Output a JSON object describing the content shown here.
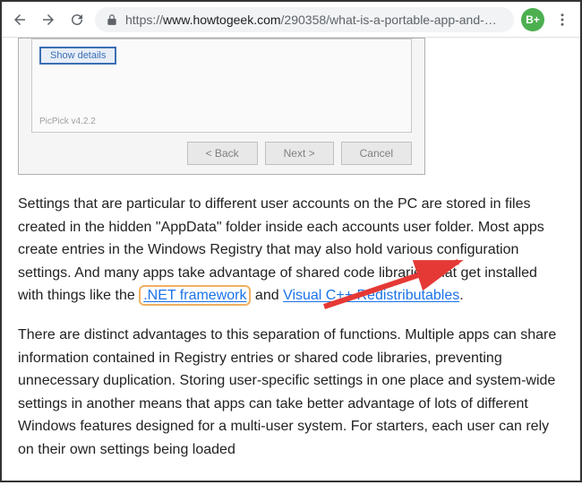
{
  "browser": {
    "url_scheme": "https://",
    "url_host": "www.howtogeek.com",
    "url_path": "/290358/what-is-a-portable-app-and-…",
    "ext_badge": "B+"
  },
  "installer": {
    "show_details": "Show details",
    "version": "PicPick v4.2.2",
    "back": "< Back",
    "next": "Next >",
    "cancel": "Cancel"
  },
  "article": {
    "p1a": "Settings that are particular to different user accounts on the PC are stored in files created in the hidden \"AppData\" folder inside each accounts user folder. Most apps create entries in the Windows Registry that may also hold various configuration settings. And many apps take advantage of shared code libraries that get installed with things like the ",
    "link_net": ".NET framework",
    "p1b": " and ",
    "link_vc": "Visual C++ Redistributables",
    "p1c": ".",
    "p2": "There are distinct advantages to this separation of functions. Multiple apps can share information contained in Registry entries or shared code libraries, preventing unnecessary duplication. Storing user-specific settings in one place and system-wide settings in another means that apps can take better advantage of lots of different Windows features designed for a multi-user system. For starters, each user can rely on their own settings being loaded"
  }
}
